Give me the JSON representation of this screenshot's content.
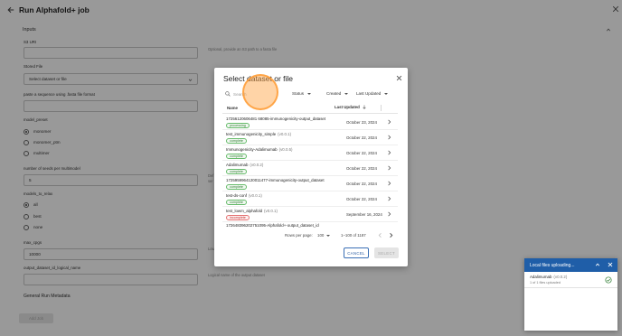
{
  "page": {
    "title": "Run Alphafold+ job",
    "section_inputs": "Inputs",
    "fields": {
      "s3_uri_label": "S3 URI",
      "s3_uri_helper": "Optional, provide an S3 path to a fasta file",
      "stored_file_label": "Stored File",
      "stored_file_value": "Select dataset or file",
      "paste_sequence_label": "paste a sequence using .fasta file format",
      "model_preset_label": "model_preset",
      "model_preset_options": [
        "monomer",
        "monomer_ptm",
        "multimer"
      ],
      "num_seeds_label": "number of seeds per multimodel",
      "num_seeds_value": "5",
      "models_to_relax_label": "models_to_relax",
      "models_to_relax_options": [
        "all",
        "best",
        "none"
      ],
      "max_cpgs_label": "max_cpgs",
      "max_cpgs_value": "10000",
      "output_dataset_label": "output_dataset_id_logical_name",
      "helper_def": "Def",
      "helper_ser": "ser",
      "helper_low": "Low",
      "output_helper": "Logical name of the output dataset"
    },
    "section_general": "General Run Metadata",
    "add_job_label": "Add Job"
  },
  "modal": {
    "title": "Select dataset or file",
    "search_placeholder": "Search",
    "filters": [
      "Status",
      "Created",
      "Last Updated"
    ],
    "columns": {
      "name": "Name",
      "last_updated": "Last Updated"
    },
    "rows": [
      {
        "name": "17256120606481 68085-immunogenicity-output_dataset",
        "version": "",
        "status": "processing",
        "date": "October 23, 2024"
      },
      {
        "name": "test_immunogenicity_simple",
        "version": "(v0.0.1)",
        "status": "complete",
        "date": "October 22, 2024"
      },
      {
        "name": "Immunogenicity-Adalimumab",
        "version": "(v0.0.5)",
        "status": "complete",
        "date": "October 22, 2024"
      },
      {
        "name": "Adalimumab",
        "version": "(v0.0.2)",
        "status": "complete",
        "date": "October 22, 2024"
      },
      {
        "name": "1725959964120011477-immunogenicity-output_dataset",
        "version": "",
        "status": "complete",
        "date": "October 22, 2024"
      },
      {
        "name": "test-ds-conf",
        "version": "(v0.0.1)",
        "status": "complete",
        "date": "October 22, 2024"
      },
      {
        "name": "test_lowm_alphafold",
        "version": "(v0.0.1)",
        "status": "incomplete",
        "date": "September 16, 2024"
      },
      {
        "name": "172648396202751095-Alphafold+-output_dataset_id",
        "version": "",
        "status": "",
        "date": ""
      }
    ],
    "pager": {
      "rows_per_page_label": "Rows per page:",
      "rows_per_page_value": "100",
      "range": "1–100 of 1187"
    },
    "cancel_label": "CANCEL",
    "select_label": "SELECT"
  },
  "upload_panel": {
    "title": "Local files uploading...",
    "item_name": "Adalimumab",
    "item_version": "(v0.0.2)",
    "item_status": "1 of 1 files uploaded"
  }
}
